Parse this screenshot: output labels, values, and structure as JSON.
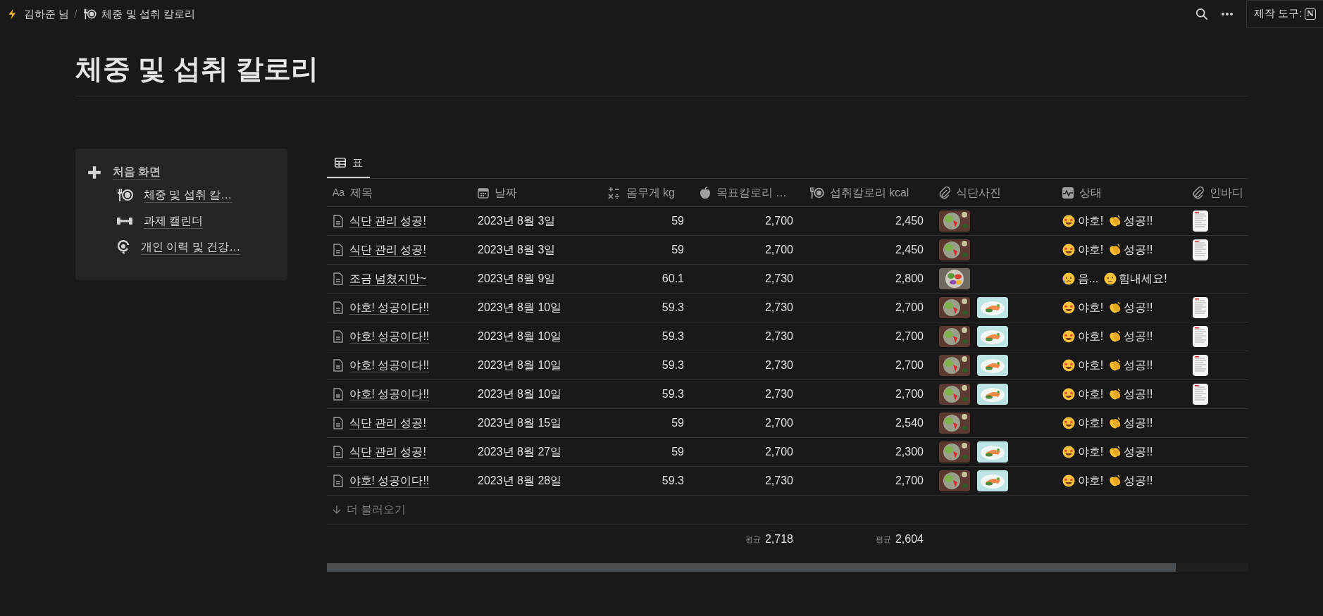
{
  "breadcrumb": [
    {
      "kind": "lightning",
      "label": "김하준 님"
    },
    {
      "kind": "utensils",
      "label": "체중 및 섭취 칼로리"
    }
  ],
  "breadcrumb_separator": "/",
  "topbar": {
    "made_with": "제작 도구:",
    "logo": "N"
  },
  "title": "체중 및 섭취 칼로리",
  "sidebar": {
    "items": [
      {
        "label": "처음 화면",
        "kind": "plus",
        "children": [
          {
            "label": "체중 및 섭취 칼…",
            "kind": "utensils"
          },
          {
            "label": "과제 캘린더",
            "kind": "dumbbell"
          },
          {
            "label": "개인 이력 및 건강…",
            "kind": "refresh"
          }
        ]
      }
    ]
  },
  "views": [
    {
      "label": "표",
      "selected": true
    }
  ],
  "table": {
    "columns": [
      {
        "label": "제목",
        "kind": "title",
        "icon_text": "Aa"
      },
      {
        "label": "날짜",
        "kind": "date"
      },
      {
        "label": "몸무게 kg",
        "kind": "number"
      },
      {
        "label": "목표칼로리 …",
        "kind": "apple",
        "aggregate": {
          "label": "평균",
          "value": "2,718"
        }
      },
      {
        "label": "섭취칼로리 kcal",
        "kind": "utensils",
        "aggregate": {
          "label": "평균",
          "value": "2,604"
        }
      },
      {
        "label": "식단사진",
        "kind": "files"
      },
      {
        "label": "상태",
        "kind": "status"
      },
      {
        "label": "인바디",
        "kind": "files"
      }
    ],
    "rows": [
      {
        "title": "식단 관리 성공!",
        "date": "2023년 8월 3일",
        "weight": "59",
        "target": "2,700",
        "intake": "2,450",
        "photos": [
          {
            "kind": "picture"
          }
        ],
        "status": [
          {
            "kind": "star-eyes",
            "text": "야호!"
          },
          {
            "kind": "clap",
            "text": "성공!!"
          }
        ],
        "inbody": {
          "kind": "picture"
        }
      },
      {
        "title": "식단 관리 성공!",
        "date": "2023년 8월 3일",
        "weight": "59",
        "target": "2,700",
        "intake": "2,450",
        "photos": [
          {
            "kind": "picture"
          }
        ],
        "status": [
          {
            "kind": "star-eyes",
            "text": "야호!"
          },
          {
            "kind": "clap",
            "text": "성공!!"
          }
        ],
        "inbody": {
          "kind": "picture"
        }
      },
      {
        "title": "조금 넘쳤지만~",
        "date": "2023년 8월 9일",
        "weight": "60.1",
        "target": "2,730",
        "intake": "2,800",
        "photos": [
          {
            "kind": "picture"
          }
        ],
        "status": [
          {
            "kind": "tear",
            "text": "음..."
          },
          {
            "kind": "wink",
            "text": "힘내세요!"
          }
        ]
      },
      {
        "title": "야호! 성공이다!!",
        "date": "2023년 8월 10일",
        "weight": "59.3",
        "target": "2,730",
        "intake": "2,700",
        "photos": [
          {
            "kind": "picture"
          },
          {
            "kind": "picture"
          }
        ],
        "status": [
          {
            "kind": "star-eyes",
            "text": "야호!"
          },
          {
            "kind": "clap",
            "text": "성공!!"
          }
        ],
        "inbody": {
          "kind": "picture"
        }
      },
      {
        "title": "야호! 성공이다!!",
        "date": "2023년 8월 10일",
        "weight": "59.3",
        "target": "2,730",
        "intake": "2,700",
        "photos": [
          {
            "kind": "picture"
          },
          {
            "kind": "picture"
          }
        ],
        "status": [
          {
            "kind": "star-eyes",
            "text": "야호!"
          },
          {
            "kind": "clap",
            "text": "성공!!"
          }
        ],
        "inbody": {
          "kind": "picture"
        }
      },
      {
        "title": "야호! 성공이다!!",
        "date": "2023년 8월 10일",
        "weight": "59.3",
        "target": "2,730",
        "intake": "2,700",
        "photos": [
          {
            "kind": "picture"
          },
          {
            "kind": "picture"
          }
        ],
        "status": [
          {
            "kind": "star-eyes",
            "text": "야호!"
          },
          {
            "kind": "clap",
            "text": "성공!!"
          }
        ],
        "inbody": {
          "kind": "picture"
        }
      },
      {
        "title": "야호! 성공이다!!",
        "date": "2023년 8월 10일",
        "weight": "59.3",
        "target": "2,730",
        "intake": "2,700",
        "photos": [
          {
            "kind": "picture"
          },
          {
            "kind": "picture"
          }
        ],
        "status": [
          {
            "kind": "star-eyes",
            "text": "야호!"
          },
          {
            "kind": "clap",
            "text": "성공!!"
          }
        ],
        "inbody": {
          "kind": "picture"
        }
      },
      {
        "title": "식단 관리 성공!",
        "date": "2023년 8월 15일",
        "weight": "59",
        "target": "2,700",
        "intake": "2,540",
        "photos": [
          {
            "kind": "picture"
          }
        ],
        "status": [
          {
            "kind": "star-eyes",
            "text": "야호!"
          },
          {
            "kind": "clap",
            "text": "성공!!"
          }
        ]
      },
      {
        "title": "식단 관리 성공!",
        "date": "2023년 8월 27일",
        "weight": "59",
        "target": "2,700",
        "intake": "2,300",
        "photos": [
          {
            "kind": "picture"
          },
          {
            "kind": "picture"
          }
        ],
        "status": [
          {
            "kind": "star-eyes",
            "text": "야호!"
          },
          {
            "kind": "clap",
            "text": "성공!!"
          }
        ]
      },
      {
        "title": "야호! 성공이다!!",
        "date": "2023년 8월 28일",
        "weight": "59.3",
        "target": "2,730",
        "intake": "2,700",
        "photos": [
          {
            "kind": "picture"
          },
          {
            "kind": "picture"
          }
        ],
        "status": [
          {
            "kind": "star-eyes",
            "text": "야호!"
          },
          {
            "kind": "clap",
            "text": "성공!!"
          }
        ]
      }
    ],
    "load_more": "더 불러오기"
  }
}
